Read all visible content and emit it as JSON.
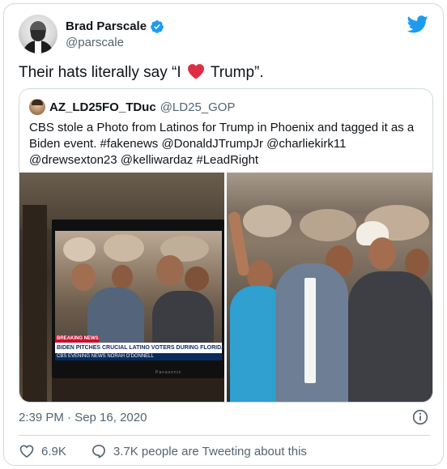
{
  "tweet": {
    "author": {
      "display_name": "Brad Parscale",
      "handle": "@parscale",
      "verified": true
    },
    "text_before": "Their hats literally say “I",
    "text_after": "Trump”.",
    "emoji": "red-heart",
    "timestamp": "2:39 PM · Sep 16, 2020",
    "likes": "6.9K",
    "conversation": "3.7K people are Tweeting about this"
  },
  "quoted_tweet": {
    "display_name": "AZ_LD25FO_TDuc",
    "handle": "@LD25_GOP",
    "text": "CBS stole a Photo from Latinos for Trump in Phoenix and tagged it as a Biden event. #fakenews @DonaldJTrumpJr @charliekirk11 @drewsexton23 @kelliwardaz #LeadRight"
  },
  "media_left": {
    "chyron_tag": "BREAKING NEWS",
    "chyron_headline": "BIDEN PITCHES CRUCIAL LATINO VOTERS DURING FLORIDA CAMP",
    "chyron_footer": "CBS EVENING NEWS  NORAH O'DONNELL",
    "tv_brand": "Panasonic"
  },
  "colors": {
    "accent": "#1d9bf0",
    "heart": "#e0245e",
    "text_secondary": "#536471",
    "border": "#cfd9de"
  }
}
